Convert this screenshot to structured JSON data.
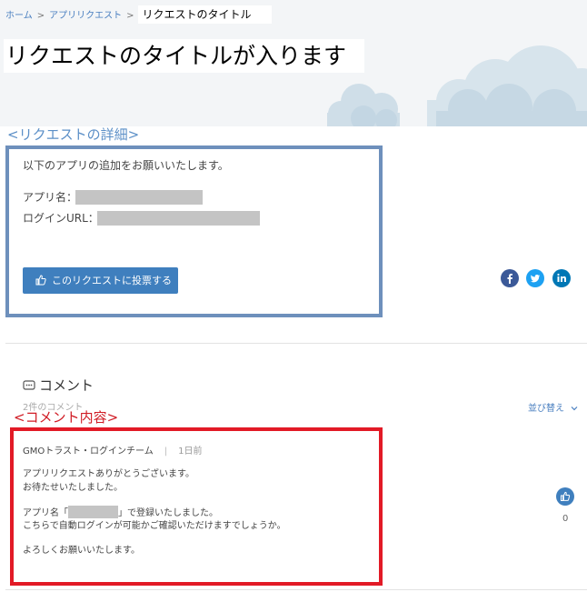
{
  "breadcrumb": {
    "items": [
      "ホーム",
      "アプリリクエスト"
    ],
    "separator": ">",
    "current": "リクエストのタイトル"
  },
  "page": {
    "title": "リクエストのタイトルが入ります"
  },
  "annotations": {
    "detail_label": "<リクエストの詳細>",
    "comment_label": "<コメント内容>",
    "detail_color": "#6e90bc",
    "comment_color": "#e21a26"
  },
  "request": {
    "intro": "以下のアプリの追加をお願いいたします。",
    "app_name_label": "アプリ名：",
    "login_url_label": "ログインURL：",
    "vote_button": "このリクエストに投票する"
  },
  "share": {
    "icons": [
      "facebook-icon",
      "twitter-icon",
      "linkedin-icon"
    ],
    "colors": {
      "facebook": "#3b5998",
      "twitter": "#1da1f2",
      "linkedin": "#0077b5"
    }
  },
  "comments": {
    "heading": "コメント",
    "count": "2件のコメント",
    "sort_label": "並び替え",
    "items": [
      {
        "author": "GMOトラスト・ログインチーム",
        "separator": "|",
        "time": "1日前",
        "line1": "アプリリクエストありがとうございます。",
        "line2": "お待たせいたしました。",
        "line3_prefix": "アプリ名「",
        "line3_suffix": "」で登録いたしました。",
        "line4": "こちらで自動ログインが可能かご確認いただけますでしょうか。",
        "line5": "よろしくお願いいたします。",
        "likes": "0"
      }
    ]
  },
  "colors": {
    "accent": "#3f7fbe",
    "link": "#4a7fc0",
    "hero_bg": "#f3f5f7"
  }
}
